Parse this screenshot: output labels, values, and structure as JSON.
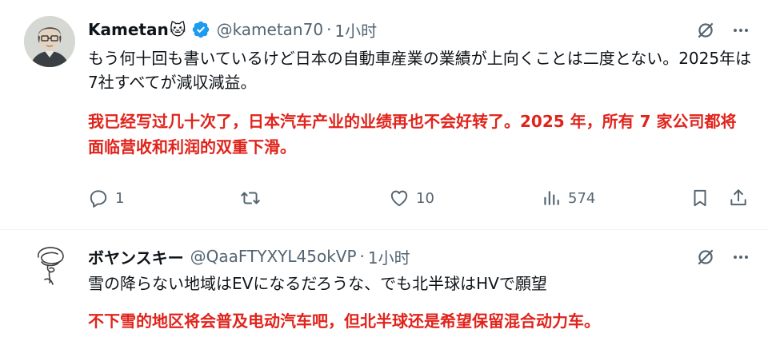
{
  "tweets": [
    {
      "name": "Kametan",
      "name_emoji": "🐱",
      "handle": "@kametan70",
      "separator": "·",
      "time": "1小时",
      "text_ja": "もう何十回も書いているけど日本の自動車産業の業績が上向くことは二度とない。2025年は7社すべてが減収減益。",
      "text_zh": "我已经写过几十次了，日本汽车产业的业绩再也不会好转了。2025 年，所有 7 家公司都将面临营收和利润的双重下滑。",
      "actions": {
        "reply_count": "1",
        "retweet_count": "",
        "like_count": "10",
        "views_count": "574"
      },
      "icons": [
        "grok-icon",
        "more-icon",
        "reply-icon",
        "retweet-icon",
        "like-icon",
        "views-icon",
        "bookmark-icon",
        "share-icon"
      ]
    },
    {
      "name": "ボヤンスキー",
      "handle": "@QaaFTYXYL45okVP",
      "separator": "·",
      "time": "1小时",
      "text_ja": "雪の降らない地域はEVになるだろうな、でも北半球はHVで願望",
      "text_zh": "不下雪的地区将会普及电动汽车吧，但北半球还是希望保留混合动力车。"
    }
  ],
  "colors": {
    "text": "#0f1419",
    "secondary": "#536471",
    "translation": "#e0231b",
    "verified": "#1d9bf0",
    "divider": "#eff3f4"
  }
}
